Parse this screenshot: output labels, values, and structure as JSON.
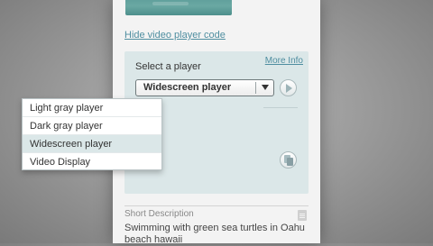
{
  "links": {
    "hide_video_player_code": "Hide video player code",
    "more_info": "More Info"
  },
  "player_select": {
    "label": "Select a player",
    "selected": "Widescreen player",
    "options": [
      {
        "label": "Light gray player",
        "selected": false
      },
      {
        "label": "Dark gray player",
        "selected": false
      },
      {
        "label": "Widescreen player",
        "selected": true
      },
      {
        "label": "Video Display",
        "selected": false
      }
    ]
  },
  "short_description": {
    "label": "Short Description",
    "text": "Swimming with green sea turtles in Oahu beach hawaii"
  },
  "icons": {
    "play": "play-icon",
    "copy": "copy-icon",
    "dropdown_arrow": "chevron-down-icon",
    "document": "document-icon"
  },
  "colors": {
    "link": "#4f8ea0",
    "player_box": "#dbe7e8",
    "selected_option": "#dbe7e8"
  }
}
